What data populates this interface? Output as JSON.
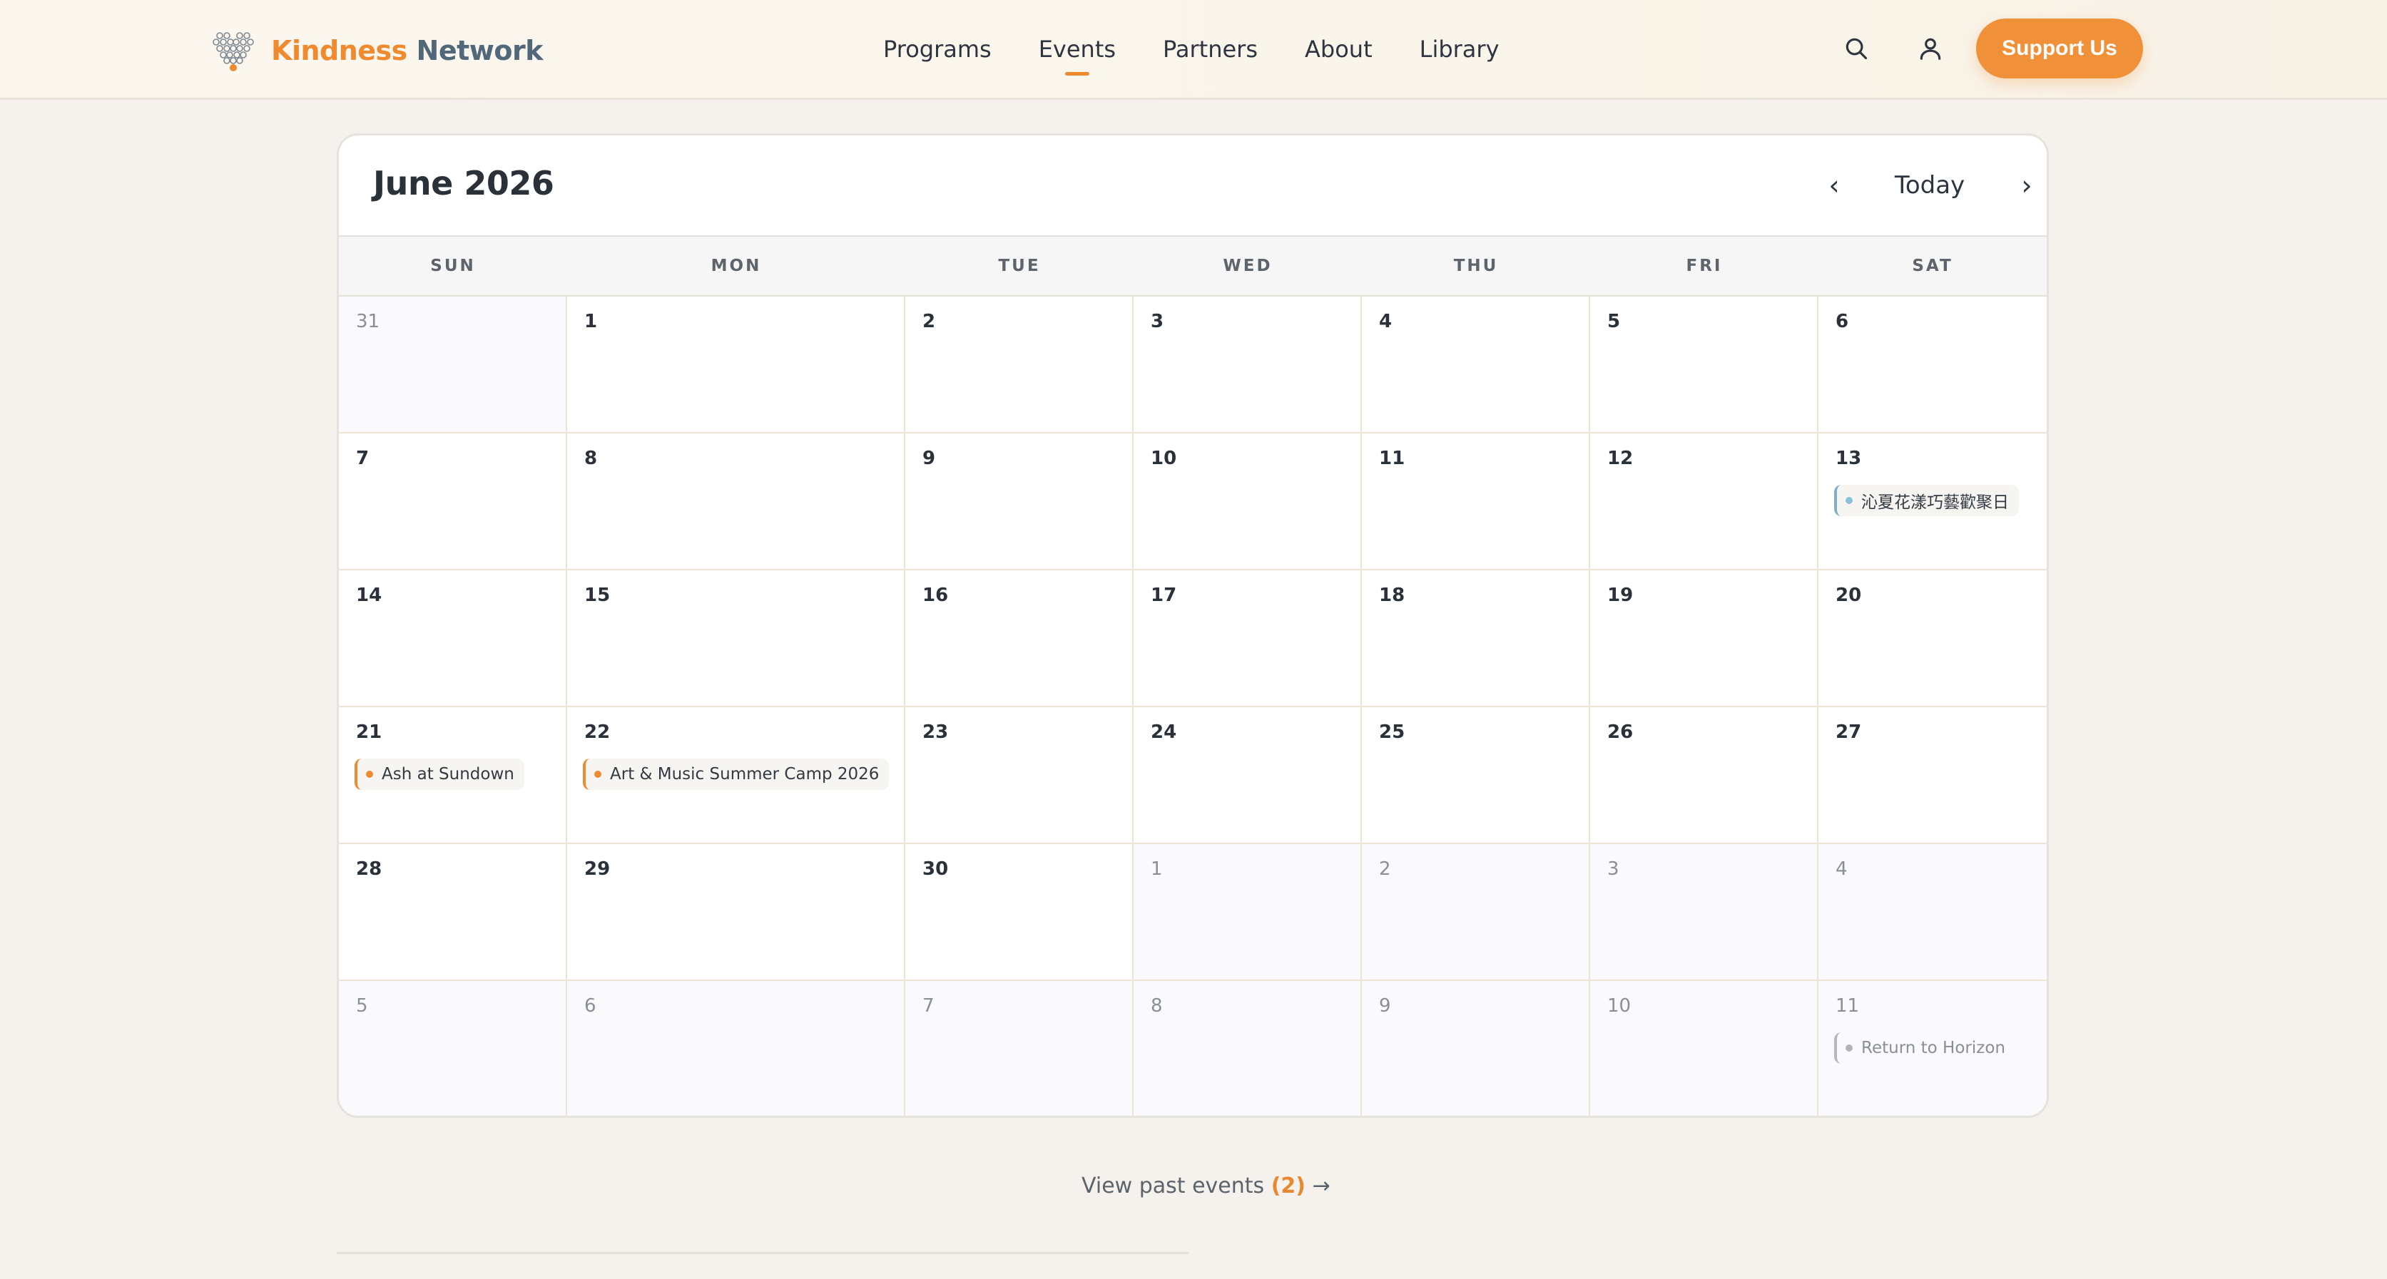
{
  "header": {
    "logo": {
      "word1": "Kindness",
      "word2": "Network"
    },
    "nav": [
      {
        "label": "Programs",
        "active": false
      },
      {
        "label": "Events",
        "active": true
      },
      {
        "label": "Partners",
        "active": false
      },
      {
        "label": "About",
        "active": false
      },
      {
        "label": "Library",
        "active": false
      }
    ],
    "icons": {
      "search": "search-icon",
      "account": "user-icon"
    },
    "support_label": "Support Us"
  },
  "calendar": {
    "title": "June 2026",
    "prev_label": "‹",
    "today_label": "Today",
    "next_label": "›",
    "weekdays": [
      "SUN",
      "MON",
      "TUE",
      "WED",
      "THU",
      "FRI",
      "SAT"
    ],
    "weeks": [
      [
        {
          "day": "31",
          "other": true
        },
        {
          "day": "1"
        },
        {
          "day": "2"
        },
        {
          "day": "3"
        },
        {
          "day": "4"
        },
        {
          "day": "5"
        },
        {
          "day": "6"
        }
      ],
      [
        {
          "day": "7"
        },
        {
          "day": "8"
        },
        {
          "day": "9"
        },
        {
          "day": "10"
        },
        {
          "day": "11"
        },
        {
          "day": "12"
        },
        {
          "day": "13",
          "event": {
            "title": "沁夏花漾巧藝歡聚日",
            "style": "blue"
          }
        }
      ],
      [
        {
          "day": "14"
        },
        {
          "day": "15"
        },
        {
          "day": "16"
        },
        {
          "day": "17"
        },
        {
          "day": "18"
        },
        {
          "day": "19"
        },
        {
          "day": "20"
        }
      ],
      [
        {
          "day": "21",
          "event": {
            "title": "Ash at Sundown",
            "style": "orange"
          }
        },
        {
          "day": "22",
          "event": {
            "title": "Art & Music Summer Camp 2026",
            "style": "orange"
          }
        },
        {
          "day": "23"
        },
        {
          "day": "24"
        },
        {
          "day": "25"
        },
        {
          "day": "26"
        },
        {
          "day": "27"
        }
      ],
      [
        {
          "day": "28"
        },
        {
          "day": "29"
        },
        {
          "day": "30"
        },
        {
          "day": "1",
          "other": true
        },
        {
          "day": "2",
          "other": true
        },
        {
          "day": "3",
          "other": true
        },
        {
          "day": "4",
          "other": true
        }
      ],
      [
        {
          "day": "5",
          "other": true
        },
        {
          "day": "6",
          "other": true
        },
        {
          "day": "7",
          "other": true
        },
        {
          "day": "8",
          "other": true
        },
        {
          "day": "9",
          "other": true
        },
        {
          "day": "10",
          "other": true
        },
        {
          "day": "11",
          "other": true,
          "event": {
            "title": "Return to Horizon",
            "style": "grey"
          }
        }
      ]
    ]
  },
  "footer": {
    "past_label": "View past events",
    "past_count": "(2)",
    "arrow": "→"
  },
  "colors": {
    "accent": "#ef8a2f",
    "brand_slate": "#51687a",
    "background": "#f5f1ec"
  }
}
